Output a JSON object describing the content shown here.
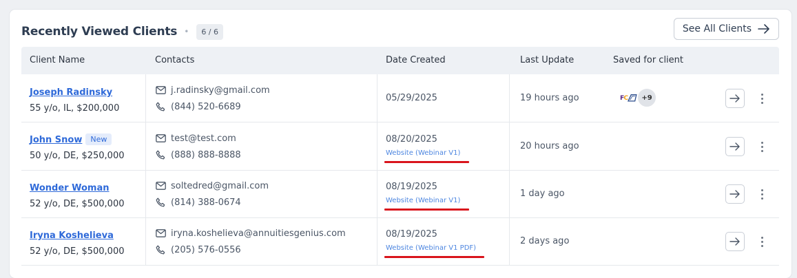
{
  "header": {
    "title": "Recently Viewed Clients",
    "separator": "•",
    "count": "6 / 6",
    "see_all_label": "See All Clients"
  },
  "table": {
    "columns": [
      "Client Name",
      "Contacts",
      "Date Created",
      "Last Update",
      "Saved for client"
    ],
    "rows": [
      {
        "name": "Joseph Radinsky",
        "info": "55 y/o, IL, $200,000",
        "badge": "",
        "email": "j.radinsky@gmail.com",
        "phone": "(844) 520-6689",
        "date": "05/29/2025",
        "source": "",
        "last_update": "19 hours ago",
        "saved_extra": "+9"
      },
      {
        "name": "John Snow",
        "info": "50 y/o, DE, $250,000",
        "badge": "New",
        "email": "test@test.com",
        "phone": "(888) 888-8888",
        "date": "08/20/2025",
        "source": "Website (Webinar V1)",
        "last_update": "20 hours ago",
        "saved_extra": ""
      },
      {
        "name": "Wonder Woman",
        "info": "52 y/o, DE, $500,000",
        "badge": "",
        "email": "soltedred@gmail.com",
        "phone": "(814) 388-0674",
        "date": "08/19/2025",
        "source": "Website (Webinar V1)",
        "last_update": "1 day ago",
        "saved_extra": ""
      },
      {
        "name": "Iryna Koshelieva",
        "info": "52 y/o, DE, $500,000",
        "badge": "",
        "email": "iryna.koshelieva@annuitiesgenius.com",
        "phone": "(205) 576-0556",
        "date": "08/19/2025",
        "source": "Website (Webinar V1 PDF)",
        "last_update": "2 days ago",
        "saved_extra": ""
      }
    ]
  },
  "icons": {
    "email": "mail-icon",
    "phone": "phone-icon",
    "open": "arrow-right-icon",
    "more": "kebab-menu-icon"
  },
  "colors": {
    "link": "#2f6ad9",
    "source_link": "#4d86e0",
    "highlight_underline": "#d9141c",
    "header_bg": "#eef1f5"
  }
}
